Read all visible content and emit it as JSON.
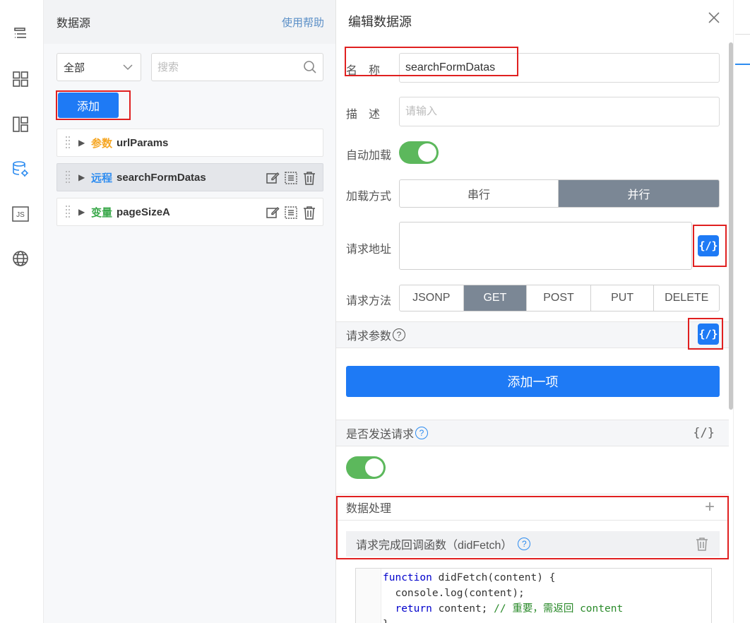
{
  "rail": {
    "icons": [
      "outline-icon",
      "components-icon",
      "layout-icon",
      "datasource-icon",
      "js-icon",
      "globe-icon"
    ],
    "js_label": "JS",
    "active_color": "#2d8cf0"
  },
  "left": {
    "title": "数据源",
    "help": "使用帮助",
    "filter_value": "全部",
    "search_placeholder": "搜索",
    "add_label": "添加",
    "items": [
      {
        "tag": "参数",
        "name": "urlParams"
      },
      {
        "tag": "远程",
        "name": "searchFormDatas"
      },
      {
        "tag": "变量",
        "name": "pageSizeA"
      }
    ]
  },
  "editor": {
    "title": "编辑数据源",
    "name_label": "名　称",
    "name_value": "searchFormDatas",
    "desc_label": "描　述",
    "desc_placeholder": "请输入",
    "autoload_label": "自动加载",
    "autoload_on": true,
    "load_mode_label": "加载方式",
    "load_modes": [
      "串行",
      "并行"
    ],
    "load_mode_selected": "并行",
    "url_label": "请求地址",
    "code_glyph": "{/}",
    "method_label": "请求方法",
    "methods": [
      "JSONP",
      "GET",
      "POST",
      "PUT",
      "DELETE"
    ],
    "method_selected": "GET",
    "params_label": "请求参数",
    "help_glyph": "?",
    "add_item_label": "添加一项",
    "send_label": "是否发送请求",
    "send_on": true,
    "data_proc_label": "数据处理",
    "plus_glyph": "+",
    "did_fetch_label": "请求完成回调函数（didFetch）",
    "code_lines": {
      "l1_kw": "function",
      "l1_rest": " didFetch(content) {",
      "l2": "  console.log(content);",
      "l3_kw": "  return",
      "l3_rest": " content; ",
      "l3_comment": "// 重要，需返回 content",
      "l4": "}"
    }
  },
  "colors": {
    "primary": "#1e7af5",
    "toggle_on": "#5cb85c",
    "segment_active": "#7b8795",
    "highlight_box": "#e02020"
  }
}
